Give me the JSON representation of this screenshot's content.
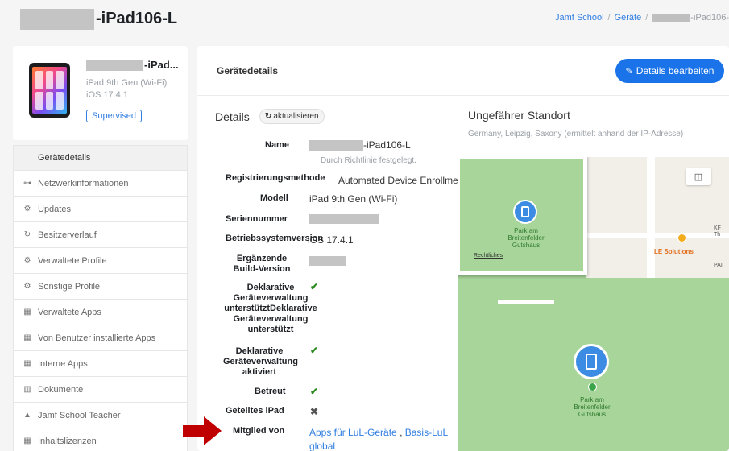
{
  "header": {
    "title_suffix": "-iPad106-L",
    "breadcrumb": {
      "home": "Jamf School",
      "sep1": "/",
      "devices": "Geräte",
      "sep2": "/",
      "current_suffix": "-iPad106-"
    }
  },
  "device": {
    "name_suffix": "-iPad...",
    "model": "iPad 9th Gen (Wi-Fi)",
    "os": "iOS 17.4.1",
    "badge": "Supervised"
  },
  "nav": {
    "items": [
      {
        "icon": "apple-icon",
        "glyph": "",
        "label": "Gerätedetails",
        "active": true
      },
      {
        "icon": "network-icon",
        "glyph": "⊶",
        "label": "Netzwerkinformationen"
      },
      {
        "icon": "gears-icon",
        "glyph": "⚙",
        "label": "Updates"
      },
      {
        "icon": "history-icon",
        "glyph": "↻",
        "label": "Besitzerverlauf"
      },
      {
        "icon": "gears-icon",
        "glyph": "⚙",
        "label": "Verwaltete Profile"
      },
      {
        "icon": "gears-icon",
        "glyph": "⚙",
        "label": "Sonstige Profile"
      },
      {
        "icon": "apps-icon",
        "glyph": "▦",
        "label": "Verwaltete Apps"
      },
      {
        "icon": "apps-icon",
        "glyph": "▦",
        "label": "Von Benutzer installierte Apps"
      },
      {
        "icon": "apps-icon",
        "glyph": "▦",
        "label": "Interne Apps"
      },
      {
        "icon": "books-icon",
        "glyph": "▥",
        "label": "Dokumente"
      },
      {
        "icon": "graduation-cap-icon",
        "glyph": "▲",
        "label": "Jamf School Teacher"
      },
      {
        "icon": "apps-icon",
        "glyph": "▦",
        "label": "Inhaltslizenzen"
      }
    ]
  },
  "main": {
    "section_title": "Gerätedetails",
    "edit_button": "Details bearbeiten",
    "edit_icon": "✎",
    "details_label": "Details",
    "refresh_button": "aktualisieren",
    "refresh_icon": "↻",
    "fields": {
      "name_label": "Name",
      "name_value_suffix": "-iPad106-L",
      "name_sub": "Durch Richtlinie festgelegt.",
      "enroll_label": "Registrierungsmethode",
      "enroll_value": "Automated Device Enrollment",
      "model_label": "Modell",
      "model_value": "iPad 9th Gen (Wi-Fi)",
      "serial_label": "Seriennummer",
      "osver_label": "Betriebssystemversion",
      "osver_value": "iOS 17.4.1",
      "build_label": "Ergänzende Build-Version",
      "decl_supported_label": "Deklarative Geräteverwaltung unterstütztDeklarative Geräteverwaltung unterstützt",
      "decl_active_label": "Deklarative Geräteverwaltung aktiviert",
      "supervised_label": "Betreut",
      "shared_label": "Geteiltes iPad",
      "member_label": "Mitglied von",
      "member_link1": "Apps für LuL-Geräte",
      "member_sep": " , ",
      "member_link2": "Basis-LuL global"
    },
    "location": {
      "title": "Ungefährer Standort",
      "subtitle": "Germany, Leipzig, Saxony (ermittelt anhand der IP-Adresse)"
    },
    "map": {
      "park_label": "Park am Breitenfelder Gutshaus",
      "legal": "Rechtliches",
      "poi": "LE Solutions",
      "edge_label_1": "KF",
      "edge_label_2": "Th",
      "edge_label_3": "PAI",
      "map_mode_icon": "◫"
    }
  },
  "colors": {
    "accent": "#1a73e8",
    "link": "#2f7de1",
    "check": "#2e8b22",
    "arrow": "#c00000",
    "park": "#a8d69a"
  }
}
